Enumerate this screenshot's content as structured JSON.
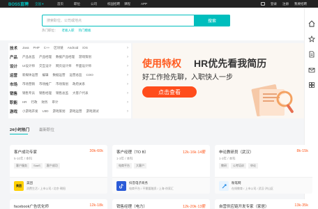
{
  "topnav": {
    "logo": "BOSS直聘",
    "city": "全国 ▾",
    "links": [
      "首页",
      "职位",
      "公司",
      "校园招聘",
      "课程",
      "APP"
    ],
    "right": [
      "登录",
      "注册",
      "我要招聘"
    ]
  },
  "search": {
    "placeholder": "搜索职位、公司或地点",
    "button": "搜索",
    "hot_label": "热门职位：",
    "hot_links": [
      "老板入职",
      "热门模板"
    ]
  },
  "categories": [
    {
      "title": "技术",
      "items": [
        "Java",
        "PHP",
        "C++",
        "区块链",
        "Android",
        "iOS"
      ]
    },
    {
      "title": "产品",
      "items": [
        "产品总监",
        "产品经理",
        "数据产品经理",
        "游戏策划"
      ]
    },
    {
      "title": "设计",
      "items": [
        "UI设计师",
        "交互设计",
        "网页设计师",
        "平面设计师"
      ]
    },
    {
      "title": "运营",
      "items": [
        "新媒体运营",
        "编辑",
        "数据运营",
        "运营总监",
        "COO"
      ]
    },
    {
      "title": "市场",
      "items": [
        "市场营销",
        "市场推广",
        "市场策划",
        "政府关系"
      ]
    },
    {
      "title": "销售",
      "items": [
        "销售专员",
        "销售经理",
        "销售总监",
        "大客户代表"
      ]
    },
    {
      "title": "职能",
      "items": [
        "HR",
        "行政",
        "财务",
        "审计"
      ]
    },
    {
      "title": "游戏",
      "items": [
        "小游戏开发",
        "U3D",
        "游戏策划",
        "游戏运营",
        "游戏测试"
      ]
    }
  ],
  "banner": {
    "headline_a": "使用特权",
    "headline_b": "HR优先看我简历",
    "subline": "好工作抢先聊，入职快人一步",
    "button": "点击查看"
  },
  "tabs": {
    "active": "24小时热门",
    "inactive": "最新职位"
  },
  "jobs": [
    {
      "title": "客户成功专家",
      "salary": "30k-60k",
      "req": "5-10年 / 本科",
      "tags": [
        "客户服务",
        "SaaS",
        "客户成功"
      ],
      "logo_text": "美团",
      "logo_bg": "#ffd000",
      "company": "美团",
      "info": "消费生活 / 上市公司 / 北京·朝阳"
    },
    {
      "title": "客户经理（TO B）",
      "salary": "12k-16k·14薪",
      "req": "1-3年 / 本科",
      "tags": [
        "电商平台",
        "大客户"
      ],
      "logo_text": "",
      "logo_bg": "#2b5bd7",
      "company": "抖音电子商务",
      "info": "电商平台 / 不需要融资 / 上海·徐家汇"
    },
    {
      "title": "申论教研员（武汉）",
      "salary": "8k-15k",
      "req": "1-3年 / 本科",
      "tags": [
        "教研",
        "公考培训",
        "申论"
      ],
      "logo_text": "",
      "logo_bg": "#e8f4ff",
      "company": "粉笔网",
      "info": "在线教育 / 上市公司 / 武汉·洪山区"
    }
  ],
  "jobs2": [
    {
      "title": "facebook广告优化师",
      "salary": "12k-18k"
    },
    {
      "title": "销售经理（电力）",
      "salary": "12k-20k·13薪"
    },
    {
      "title": "自营供应链开发专家（家居）",
      "salary": "13k-35k"
    }
  ]
}
